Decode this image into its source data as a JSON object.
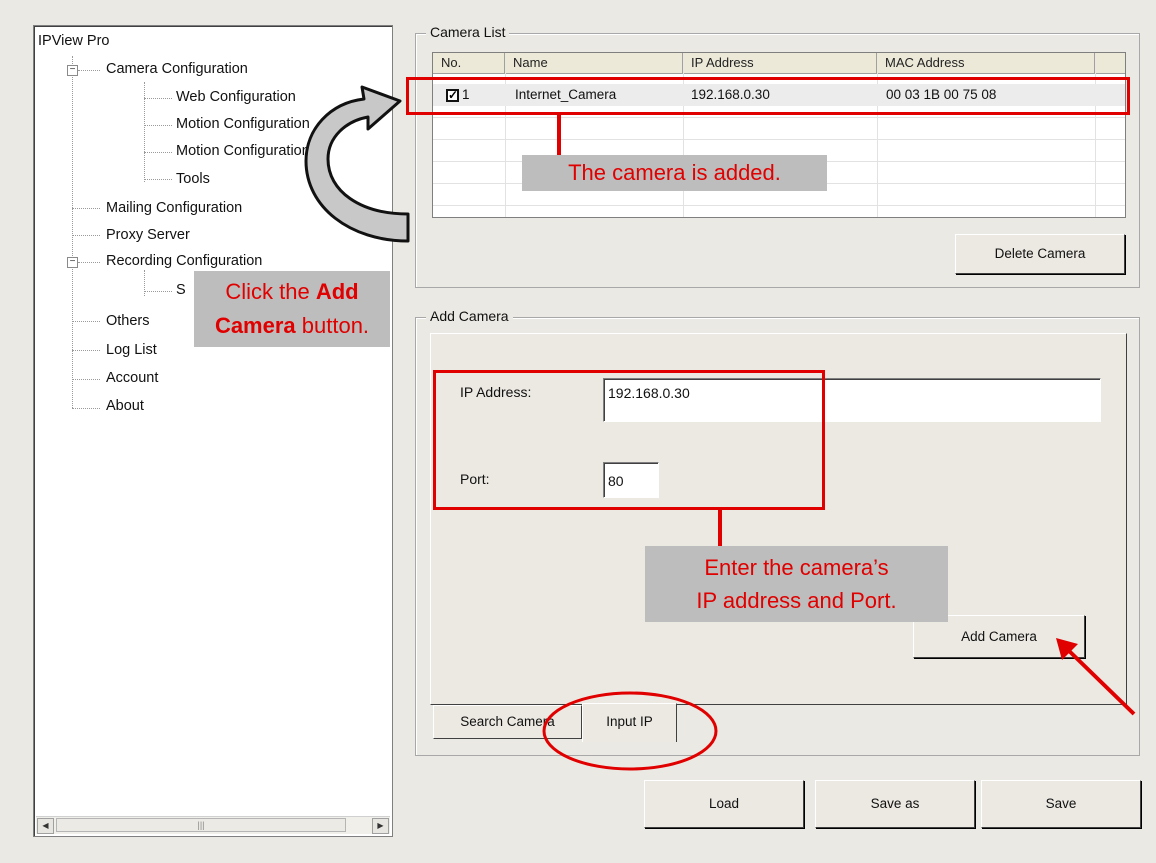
{
  "tree": {
    "root": "IPView Pro",
    "items": [
      {
        "label": "Camera Configuration",
        "toggle": "−"
      },
      {
        "label": "Web Configuration"
      },
      {
        "label": "Motion Configuration"
      },
      {
        "label": "Motion Configuration"
      },
      {
        "label": "Tools"
      },
      {
        "label": "Mailing Configuration"
      },
      {
        "label": "Proxy Server"
      },
      {
        "label": "Recording Configuration",
        "toggle": "−"
      },
      {
        "label": "S"
      },
      {
        "label": "Others"
      },
      {
        "label": "Log List"
      },
      {
        "label": "Account"
      },
      {
        "label": "About"
      }
    ],
    "scroll_left": "◀",
    "scroll_right": "▶",
    "scroll_grip": "|||"
  },
  "camera_list": {
    "title": "Camera List",
    "columns": [
      "No.",
      "Name",
      "IP Address",
      "MAC Address"
    ],
    "rows": [
      {
        "no": "1",
        "checked": "✓",
        "name": "Internet_Camera",
        "ip": "192.168.0.30",
        "mac": "00 03 1B 00 75 08"
      }
    ],
    "delete_button": "Delete Camera"
  },
  "add_camera": {
    "title": "Add Camera",
    "ip_label": "IP Address:",
    "ip_value": "192.168.0.30",
    "port_label": "Port:",
    "port_value": "80",
    "add_button": "Add Camera",
    "tabs": [
      "Search Camera",
      "Input IP"
    ]
  },
  "footer": {
    "load": "Load",
    "save_as": "Save as",
    "save": "Save"
  },
  "annotations": {
    "added": "The camera is added.",
    "click_prefix": "Click the ",
    "click_bold": "Add",
    "click_bold2": "Camera",
    "click_suffix": " button.",
    "enter_line1": "Enter the camera’s",
    "enter_line2": "IP address and Port.",
    "accent_color": "#e00000"
  }
}
